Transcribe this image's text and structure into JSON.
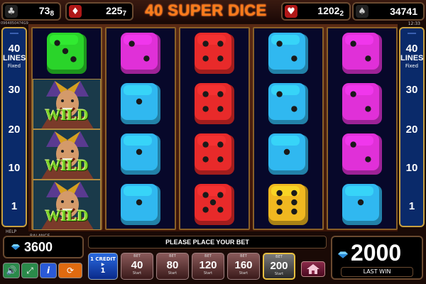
{
  "title": "40 SUPER DICE",
  "game_id": "0964850474G9",
  "clock": "12:33",
  "jackpots": [
    {
      "suit": "clubs",
      "glyph": "♣",
      "value": "73",
      "sub": "8"
    },
    {
      "suit": "diamonds",
      "glyph": "♦",
      "value": "225",
      "sub": "7"
    },
    {
      "suit": "hearts",
      "glyph": "♥",
      "value": "1202",
      "sub": "2"
    },
    {
      "suit": "spades",
      "glyph": "♠",
      "value": "34741",
      "sub": ""
    }
  ],
  "lines_panel": {
    "count": "40",
    "label": "LINES",
    "mode": "Fixed",
    "levels": [
      "30",
      "20",
      "10",
      "1"
    ]
  },
  "reels": [
    [
      "green",
      "wild",
      "wild",
      "wild"
    ],
    [
      "magenta",
      "cyan",
      "cyan",
      "cyan"
    ],
    [
      "red",
      "red",
      "red",
      "red"
    ],
    [
      "cyan",
      "cyan",
      "cyan",
      "gold"
    ],
    [
      "magenta",
      "magenta",
      "magenta",
      "cyan"
    ]
  ],
  "reel_pips": [
    [
      3,
      0,
      0,
      0
    ],
    [
      2,
      1,
      1,
      1
    ],
    [
      4,
      4,
      4,
      5
    ],
    [
      2,
      2,
      1,
      6
    ],
    [
      2,
      2,
      2,
      1
    ]
  ],
  "die_colors": {
    "green": "#2ad42a",
    "magenta": "#e030d8",
    "cyan": "#30b8f0",
    "red": "#e82a2a",
    "gold": "#f0b820"
  },
  "wild_label": "WILD",
  "help_label": "HELP",
  "balance": {
    "label": "BALANCE",
    "value": "3600"
  },
  "message": "PLEASE PLACE YOUR BET",
  "last_win": {
    "value": "2000",
    "label": "LAST WIN"
  },
  "credit": {
    "label": "1 CREDIT",
    "value": "1"
  },
  "bets": [
    {
      "top": "BET",
      "value": "40",
      "bottom": "Start"
    },
    {
      "top": "BET",
      "value": "80",
      "bottom": "Start"
    },
    {
      "top": "BET",
      "value": "120",
      "bottom": "Start"
    },
    {
      "top": "BET",
      "value": "160",
      "bottom": "Start"
    },
    {
      "top": "BET",
      "value": "200",
      "bottom": "Start",
      "active": true
    }
  ],
  "controls": [
    {
      "name": "sound-icon",
      "glyph": "🔊",
      "bg": "#2a8a4a"
    },
    {
      "name": "fullscreen-icon",
      "glyph": "⤢",
      "bg": "#2a8a4a"
    },
    {
      "name": "info-icon",
      "glyph": "i",
      "bg": "#2a5ad8"
    },
    {
      "name": "autoplay-icon",
      "glyph": "⟳",
      "bg": "#e06a10"
    }
  ]
}
